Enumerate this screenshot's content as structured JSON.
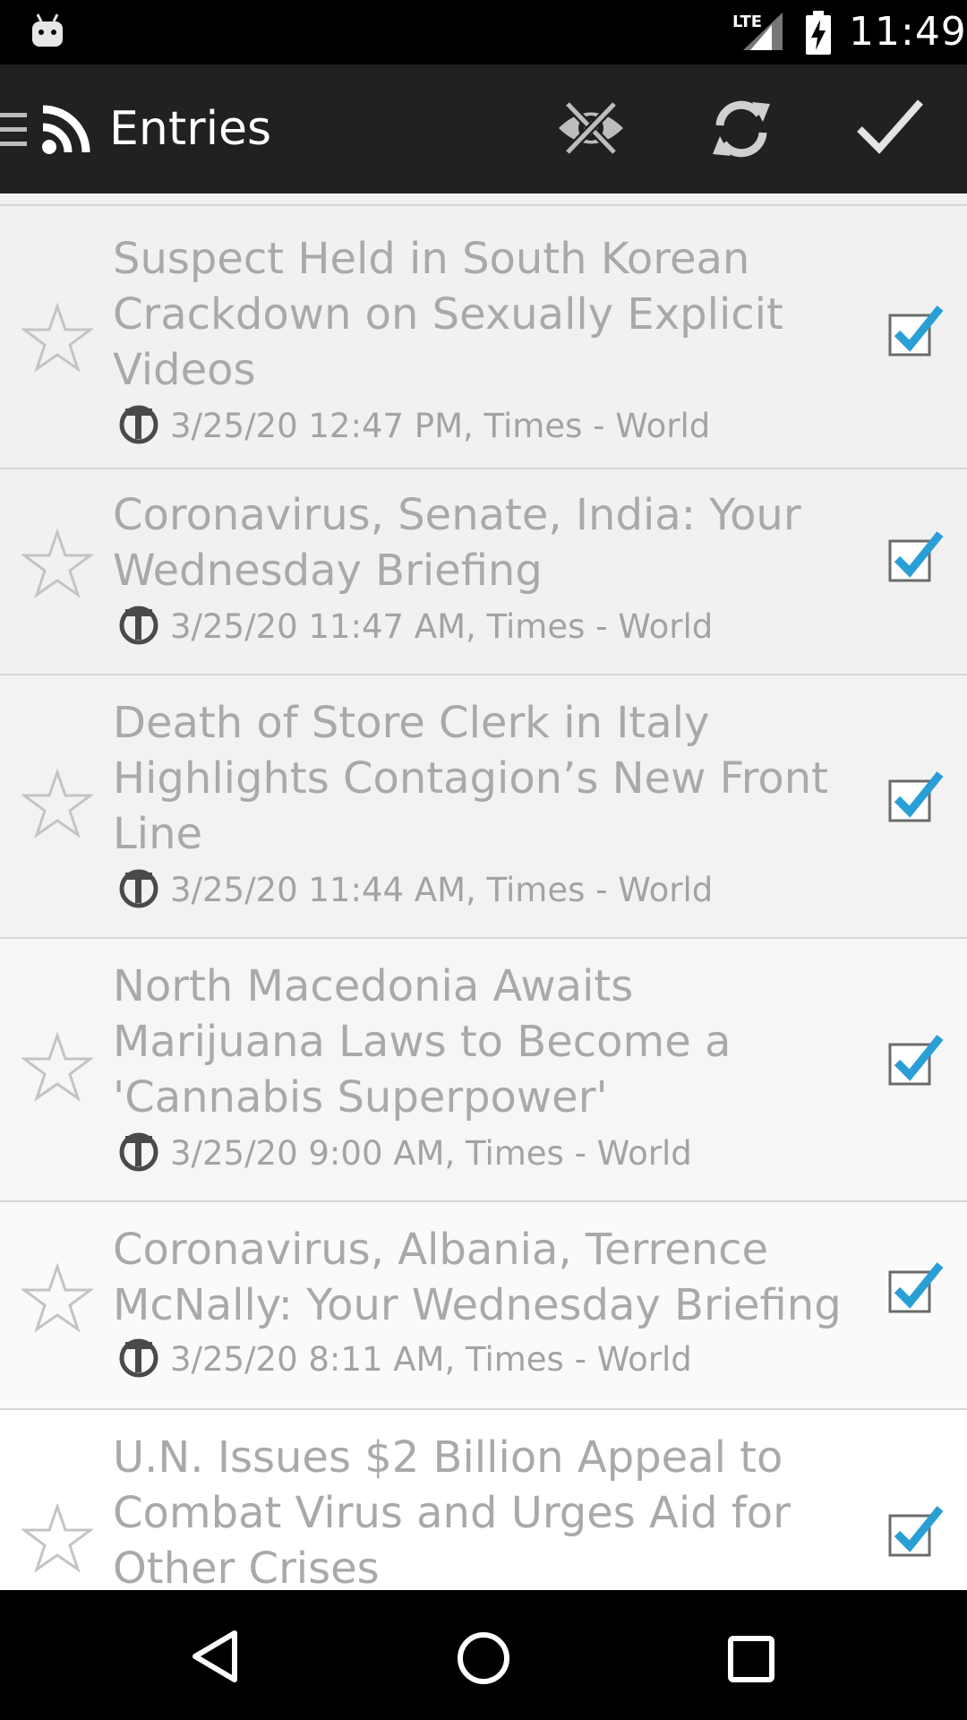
{
  "status_bar": {
    "network": "LTE",
    "time": "11:49"
  },
  "app_bar": {
    "title": "Entries",
    "actions": [
      "hide-read-icon",
      "refresh-icon",
      "mark-all-read-icon"
    ]
  },
  "colors": {
    "app_bar": "#212121",
    "check_accent": "#2a9fd6",
    "entry_text": "#a9a9a9"
  },
  "entries": [
    {
      "title": "Suspect Held in South Korean Crackdown on Sexually Explicit Videos",
      "meta": "3/25/20 12:47 PM, Times - World",
      "starred": false,
      "read": true
    },
    {
      "title": "Coronavirus, Senate, India: Your Wednesday Briefing",
      "meta": "3/25/20 11:47 AM, Times - World",
      "starred": false,
      "read": true
    },
    {
      "title": "Death of Store Clerk in Italy Highlights Contagion’s New Front Line",
      "meta": "3/25/20 11:44 AM, Times - World",
      "starred": false,
      "read": true
    },
    {
      "title": "North Macedonia Awaits Marijuana Laws to Become a 'Cannabis Superpower'",
      "meta": "3/25/20 9:00 AM, Times - World",
      "starred": false,
      "read": true
    },
    {
      "title": "Coronavirus, Albania, Terrence McNally: Your Wednesday Briefing",
      "meta": "3/25/20 8:11 AM, Times - World",
      "starred": false,
      "read": true
    },
    {
      "title": "U.N. Issues $2 Billion Appeal to Combat Virus and Urges Aid for Other Crises",
      "meta": "",
      "starred": false,
      "read": true
    }
  ]
}
